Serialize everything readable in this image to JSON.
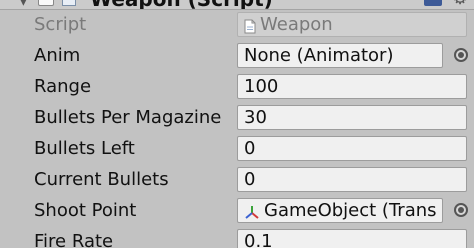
{
  "component": {
    "title": "Weapon (Script)"
  },
  "fields": {
    "script": {
      "label": "Script",
      "value": "Weapon"
    },
    "anim": {
      "label": "Anim",
      "value": "None (Animator)"
    },
    "range": {
      "label": "Range",
      "value": "100"
    },
    "bullets_per_magazine": {
      "label": "Bullets Per Magazine",
      "value": "30"
    },
    "bullets_left": {
      "label": "Bullets Left",
      "value": "0"
    },
    "current_bullets": {
      "label": "Current Bullets",
      "value": "0"
    },
    "shoot_point": {
      "label": "Shoot Point",
      "value": "GameObject (Trans"
    },
    "fire_rate": {
      "label": "Fire Rate",
      "value": "0.1"
    }
  },
  "icons": {
    "script_field": "script-file-icon",
    "shoot_point_field": "transform-axes-icon",
    "object_picker": "object-picker-icon"
  },
  "colors": {
    "panel_bg": "#c2c2c2",
    "field_bg": "#f0f0f0",
    "disabled_text": "#7a7a7a"
  }
}
